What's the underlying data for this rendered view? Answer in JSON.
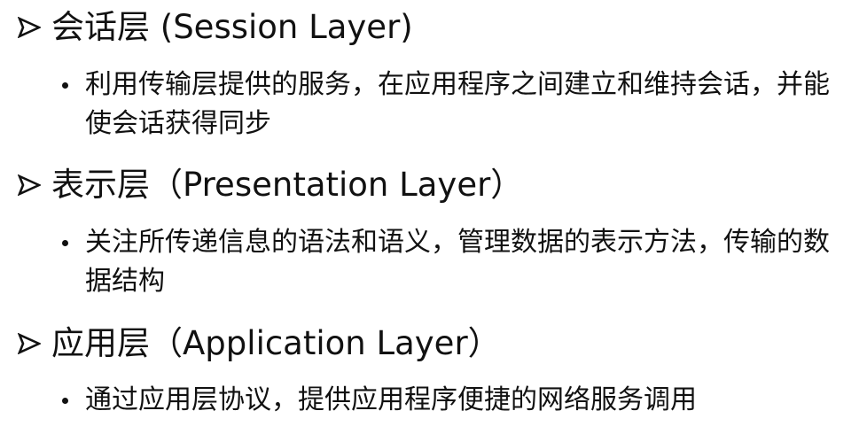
{
  "sections": [
    {
      "heading": "会话层 (Session Layer)",
      "bullet": "利用传输层提供的服务，在应用程序之间建立和维持会话，并能使会话获得同步"
    },
    {
      "heading": "表示层（Presentation Layer）",
      "bullet": "关注所传递信息的语法和语义，管理数据的表示方法，传输的数据结构"
    },
    {
      "heading": "应用层（Application Layer）",
      "bullet": "通过应用层协议，提供应用程序便捷的网络服务调用"
    }
  ]
}
